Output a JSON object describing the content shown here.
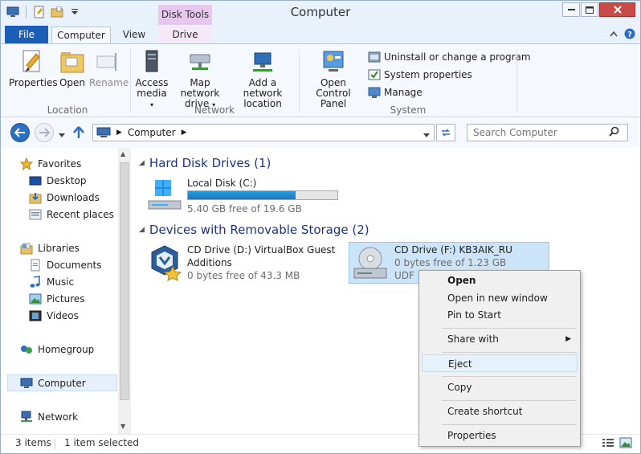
{
  "window": {
    "title": "Computer"
  },
  "ribbon_tabs": {
    "file": "File",
    "computer": "Computer",
    "view": "View",
    "context_header": "Disk Tools",
    "drive": "Drive"
  },
  "ribbon": {
    "location": {
      "label": "Location",
      "properties": "Properties",
      "open": "Open",
      "rename": "Rename"
    },
    "network": {
      "label": "Network",
      "access_media_1": "Access",
      "access_media_2": "media",
      "map_drive_1": "Map network",
      "map_drive_2": "drive",
      "add_location_1": "Add a network",
      "add_location_2": "location"
    },
    "system": {
      "label": "System",
      "control_panel_1": "Open Control",
      "control_panel_2": "Panel",
      "uninstall": "Uninstall or change a program",
      "system_properties": "System properties",
      "manage": "Manage"
    }
  },
  "address": {
    "path_item": "Computer",
    "search_placeholder": "Search Computer"
  },
  "nav": {
    "favorites": "Favorites",
    "desktop": "Desktop",
    "downloads": "Downloads",
    "recent_places": "Recent places",
    "libraries": "Libraries",
    "documents": "Documents",
    "music": "Music",
    "pictures": "Pictures",
    "videos": "Videos",
    "homegroup": "Homegroup",
    "computer": "Computer",
    "network": "Network"
  },
  "content": {
    "hard_disk_header": "Hard Disk Drives (1)",
    "removable_header": "Devices with Removable Storage (2)",
    "local_disk": {
      "name": "Local Disk (C:)",
      "free": "5.40 GB free of 19.6 GB",
      "used_fraction": 0.72
    },
    "cd_d": {
      "name_1": "CD Drive (D:) VirtualBox Guest",
      "name_2": "Additions",
      "free": "0 bytes free of 43.3 MB"
    },
    "cd_f": {
      "name": "CD Drive (F:) KB3AIK_RU",
      "free": "0 bytes free of 1.23 GB",
      "fs": "UDF"
    }
  },
  "context_menu": {
    "open": "Open",
    "open_new_window": "Open in new window",
    "pin_to_start": "Pin to Start",
    "share_with": "Share with",
    "eject": "Eject",
    "copy": "Copy",
    "create_shortcut": "Create shortcut",
    "properties": "Properties"
  },
  "status": {
    "items": "3 items",
    "selected": "1 item selected"
  },
  "colors": {
    "file_tab": "#1b5eb8",
    "context_tab": "#e7c7ee",
    "group_header": "#1e3287",
    "selection": "#cce4f7",
    "progress": "#2a9ad9"
  }
}
